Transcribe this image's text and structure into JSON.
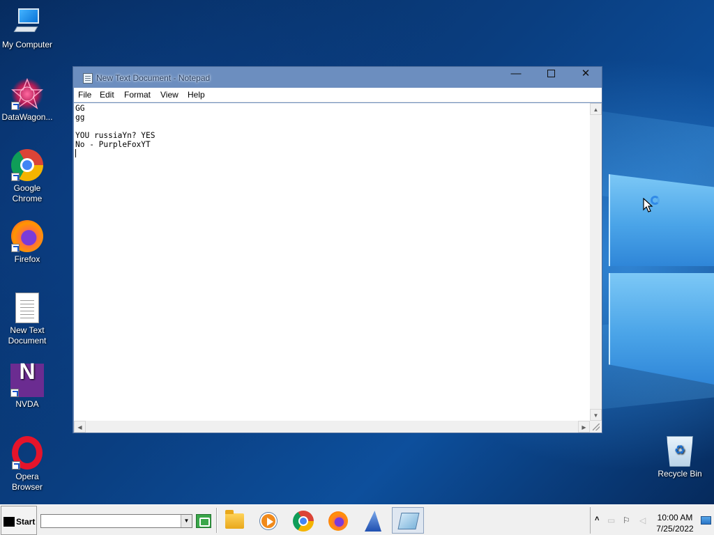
{
  "desktop": {
    "icons": [
      {
        "label": "My Computer",
        "icon": "computer-icon"
      },
      {
        "label": "DataWagon...",
        "icon": "datawagon-icon"
      },
      {
        "label": "Google Chrome",
        "icon": "chrome-icon"
      },
      {
        "label": "Firefox",
        "icon": "firefox-icon"
      },
      {
        "label": "New Text Document",
        "icon": "text-document-icon"
      },
      {
        "label": "NVDA",
        "icon": "nvda-icon"
      },
      {
        "label": "Opera Browser",
        "icon": "opera-icon"
      },
      {
        "label": "Recycle Bin",
        "icon": "recycle-bin-icon"
      }
    ]
  },
  "notepad": {
    "title": "New Text Document - Notepad",
    "controls": {
      "minimize": "—",
      "close": "✕"
    },
    "menu": [
      "File",
      "Edit",
      "Format",
      "View",
      "Help"
    ],
    "lines": [
      "GG",
      "gg",
      "",
      "YOU russiaYn? YES",
      "No - PurpleFoxYT"
    ],
    "scroll_arrows": {
      "up": "▲",
      "down": "▼",
      "left": "◀",
      "right": "▶"
    }
  },
  "taskbar": {
    "start_label": "Start",
    "address_value": "",
    "dropdown_arrow": "▼",
    "apps": [
      "file-explorer-icon",
      "media-player-icon",
      "chrome-icon",
      "firefox-icon",
      "datawagon-icon",
      "notepad-icon"
    ],
    "active_app": "notepad-icon",
    "tray": {
      "chevron": "˄",
      "time": "10:00 AM",
      "date": "7/25/2022"
    }
  },
  "colors": {
    "title_bar": "#6c8ebf",
    "taskbar": "#f0f0f0",
    "wallpaper": "#0a3e80"
  }
}
